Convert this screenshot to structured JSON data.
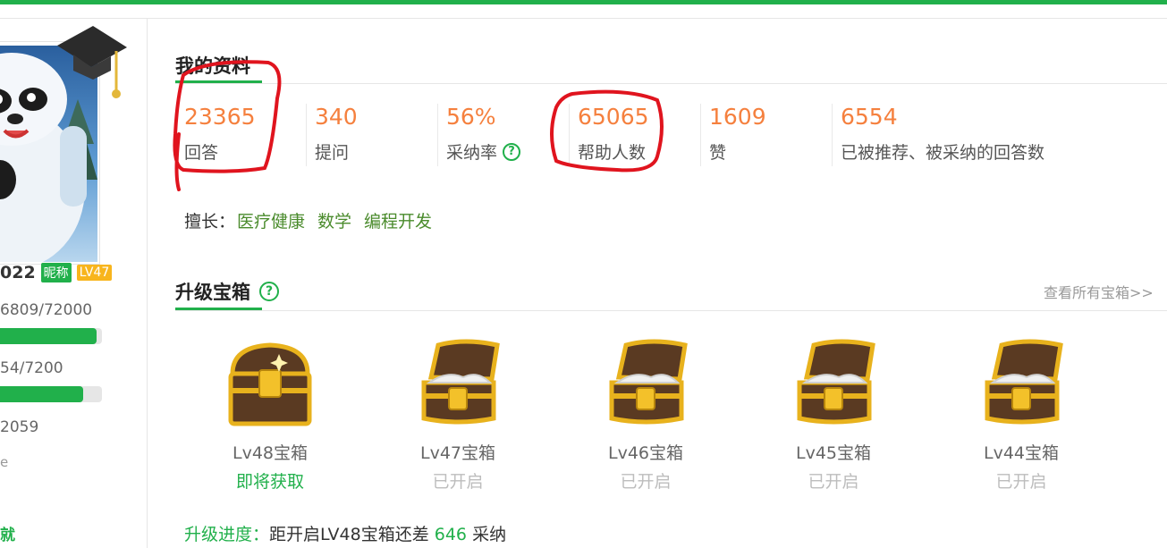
{
  "profile": {
    "name_fragment": "022",
    "nickname_badge": "昵称",
    "level_badge": "LV47",
    "exp_text": "6809/72000",
    "exp_progress": 0.95,
    "second_text": "54/7200",
    "second_progress": 0.82,
    "third_text": "2059",
    "glyph_a": "е",
    "glyph_b": "就"
  },
  "my_profile": {
    "title": "我的资料",
    "stats": [
      {
        "value": "23365",
        "label": "回答"
      },
      {
        "value": "340",
        "label": "提问"
      },
      {
        "value": "56%",
        "label": "采纳率",
        "help": "?"
      },
      {
        "value": "65065",
        "label": "帮助人数"
      },
      {
        "value": "1609",
        "label": "赞"
      },
      {
        "value": "6554",
        "label": "已被推荐、被采纳的回答数"
      }
    ],
    "skills_label": "擅长：",
    "skills": [
      "医疗健康",
      "数学",
      "编程开发"
    ]
  },
  "upgrade": {
    "title": "升级宝箱",
    "help": "?",
    "view_all": "查看所有宝箱>>",
    "chests": [
      {
        "name": "Lv48宝箱",
        "status": "即将获取",
        "state": "closed"
      },
      {
        "name": "Lv47宝箱",
        "status": "已开启",
        "state": "open"
      },
      {
        "name": "Lv46宝箱",
        "status": "已开启",
        "state": "open"
      },
      {
        "name": "Lv45宝箱",
        "status": "已开启",
        "state": "open"
      },
      {
        "name": "Lv44宝箱",
        "status": "已开启",
        "state": "open"
      }
    ],
    "progress_label": "升级进度：",
    "progress_text_a": "距开启LV48宝箱还差",
    "progress_count": "646",
    "progress_text_b": "采纳"
  },
  "colors": {
    "accent_green": "#21b04b",
    "value_orange": "#f5803e",
    "annotation_red": "#e0141e",
    "badge_orange": "#f8b51d"
  }
}
